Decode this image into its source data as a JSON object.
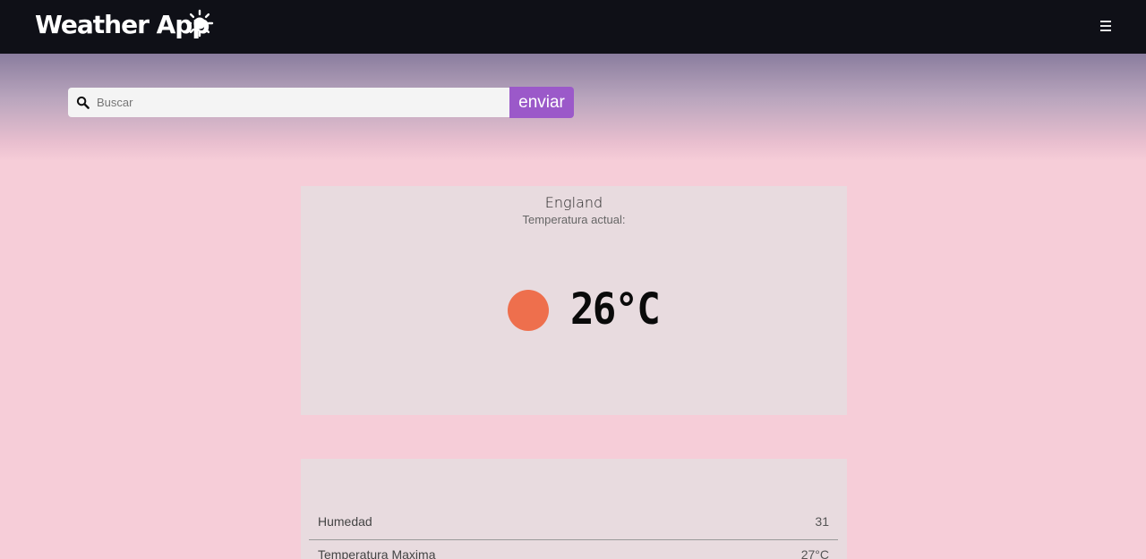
{
  "navbar": {
    "brand": "Weather App",
    "brand_icon": "sun-icon",
    "menu_icon": "hamburger-menu-icon"
  },
  "search": {
    "placeholder": "Buscar",
    "value": "",
    "button_label": "enviar",
    "icon": "search-icon"
  },
  "current": {
    "city": "England",
    "label": "Temperatura actual:",
    "temperature": "26°C",
    "indicator_color": "#ee6f4d"
  },
  "details": {
    "rows": [
      {
        "label": "Humedad",
        "value": "31"
      },
      {
        "label": "Temperatura Maxima",
        "value": "27°C"
      }
    ]
  },
  "colors": {
    "navbar_bg": "#0f1017",
    "accent": "#9b59c9",
    "page_bg": "#f6cdd8",
    "card_bg": "#e8dbdf"
  }
}
